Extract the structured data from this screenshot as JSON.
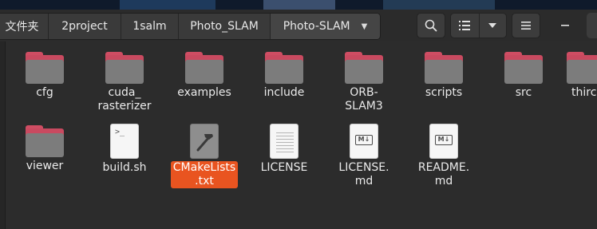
{
  "breadcrumb": [
    {
      "label": "文件夹"
    },
    {
      "label": "2project"
    },
    {
      "label": "1salm"
    },
    {
      "label": "Photo_SLAM"
    },
    {
      "label": "Photo-SLAM"
    }
  ],
  "toolbar": {
    "search_icon": "search-icon",
    "view_icon": "list-view-icon",
    "view_menu_icon": "chevron-down-icon",
    "menu_icon": "hamburger-menu-icon",
    "minimize_icon": "minimize-icon"
  },
  "items": [
    {
      "name": "cfg",
      "kind": "folder"
    },
    {
      "name": "cuda_\nrasterizer",
      "kind": "folder"
    },
    {
      "name": "examples",
      "kind": "folder"
    },
    {
      "name": "include",
      "kind": "folder"
    },
    {
      "name": "ORB-\nSLAM3",
      "kind": "folder"
    },
    {
      "name": "scripts",
      "kind": "folder"
    },
    {
      "name": "src",
      "kind": "folder"
    },
    {
      "name": "thirc",
      "kind": "folder"
    },
    {
      "name": "viewer",
      "kind": "folder"
    },
    {
      "name": "build.sh",
      "kind": "script"
    },
    {
      "name": "CMakeLists\n.txt",
      "kind": "cmake",
      "selected": true
    },
    {
      "name": "LICENSE",
      "kind": "text"
    },
    {
      "name": "LICENSE.\nmd",
      "kind": "markdown"
    },
    {
      "name": "README.\nmd",
      "kind": "markdown"
    }
  ],
  "colors": {
    "accent": "#e95420",
    "folder_tab": "#c94a60",
    "folder_body": "#7c7c7c",
    "background": "#2c2c2c"
  }
}
